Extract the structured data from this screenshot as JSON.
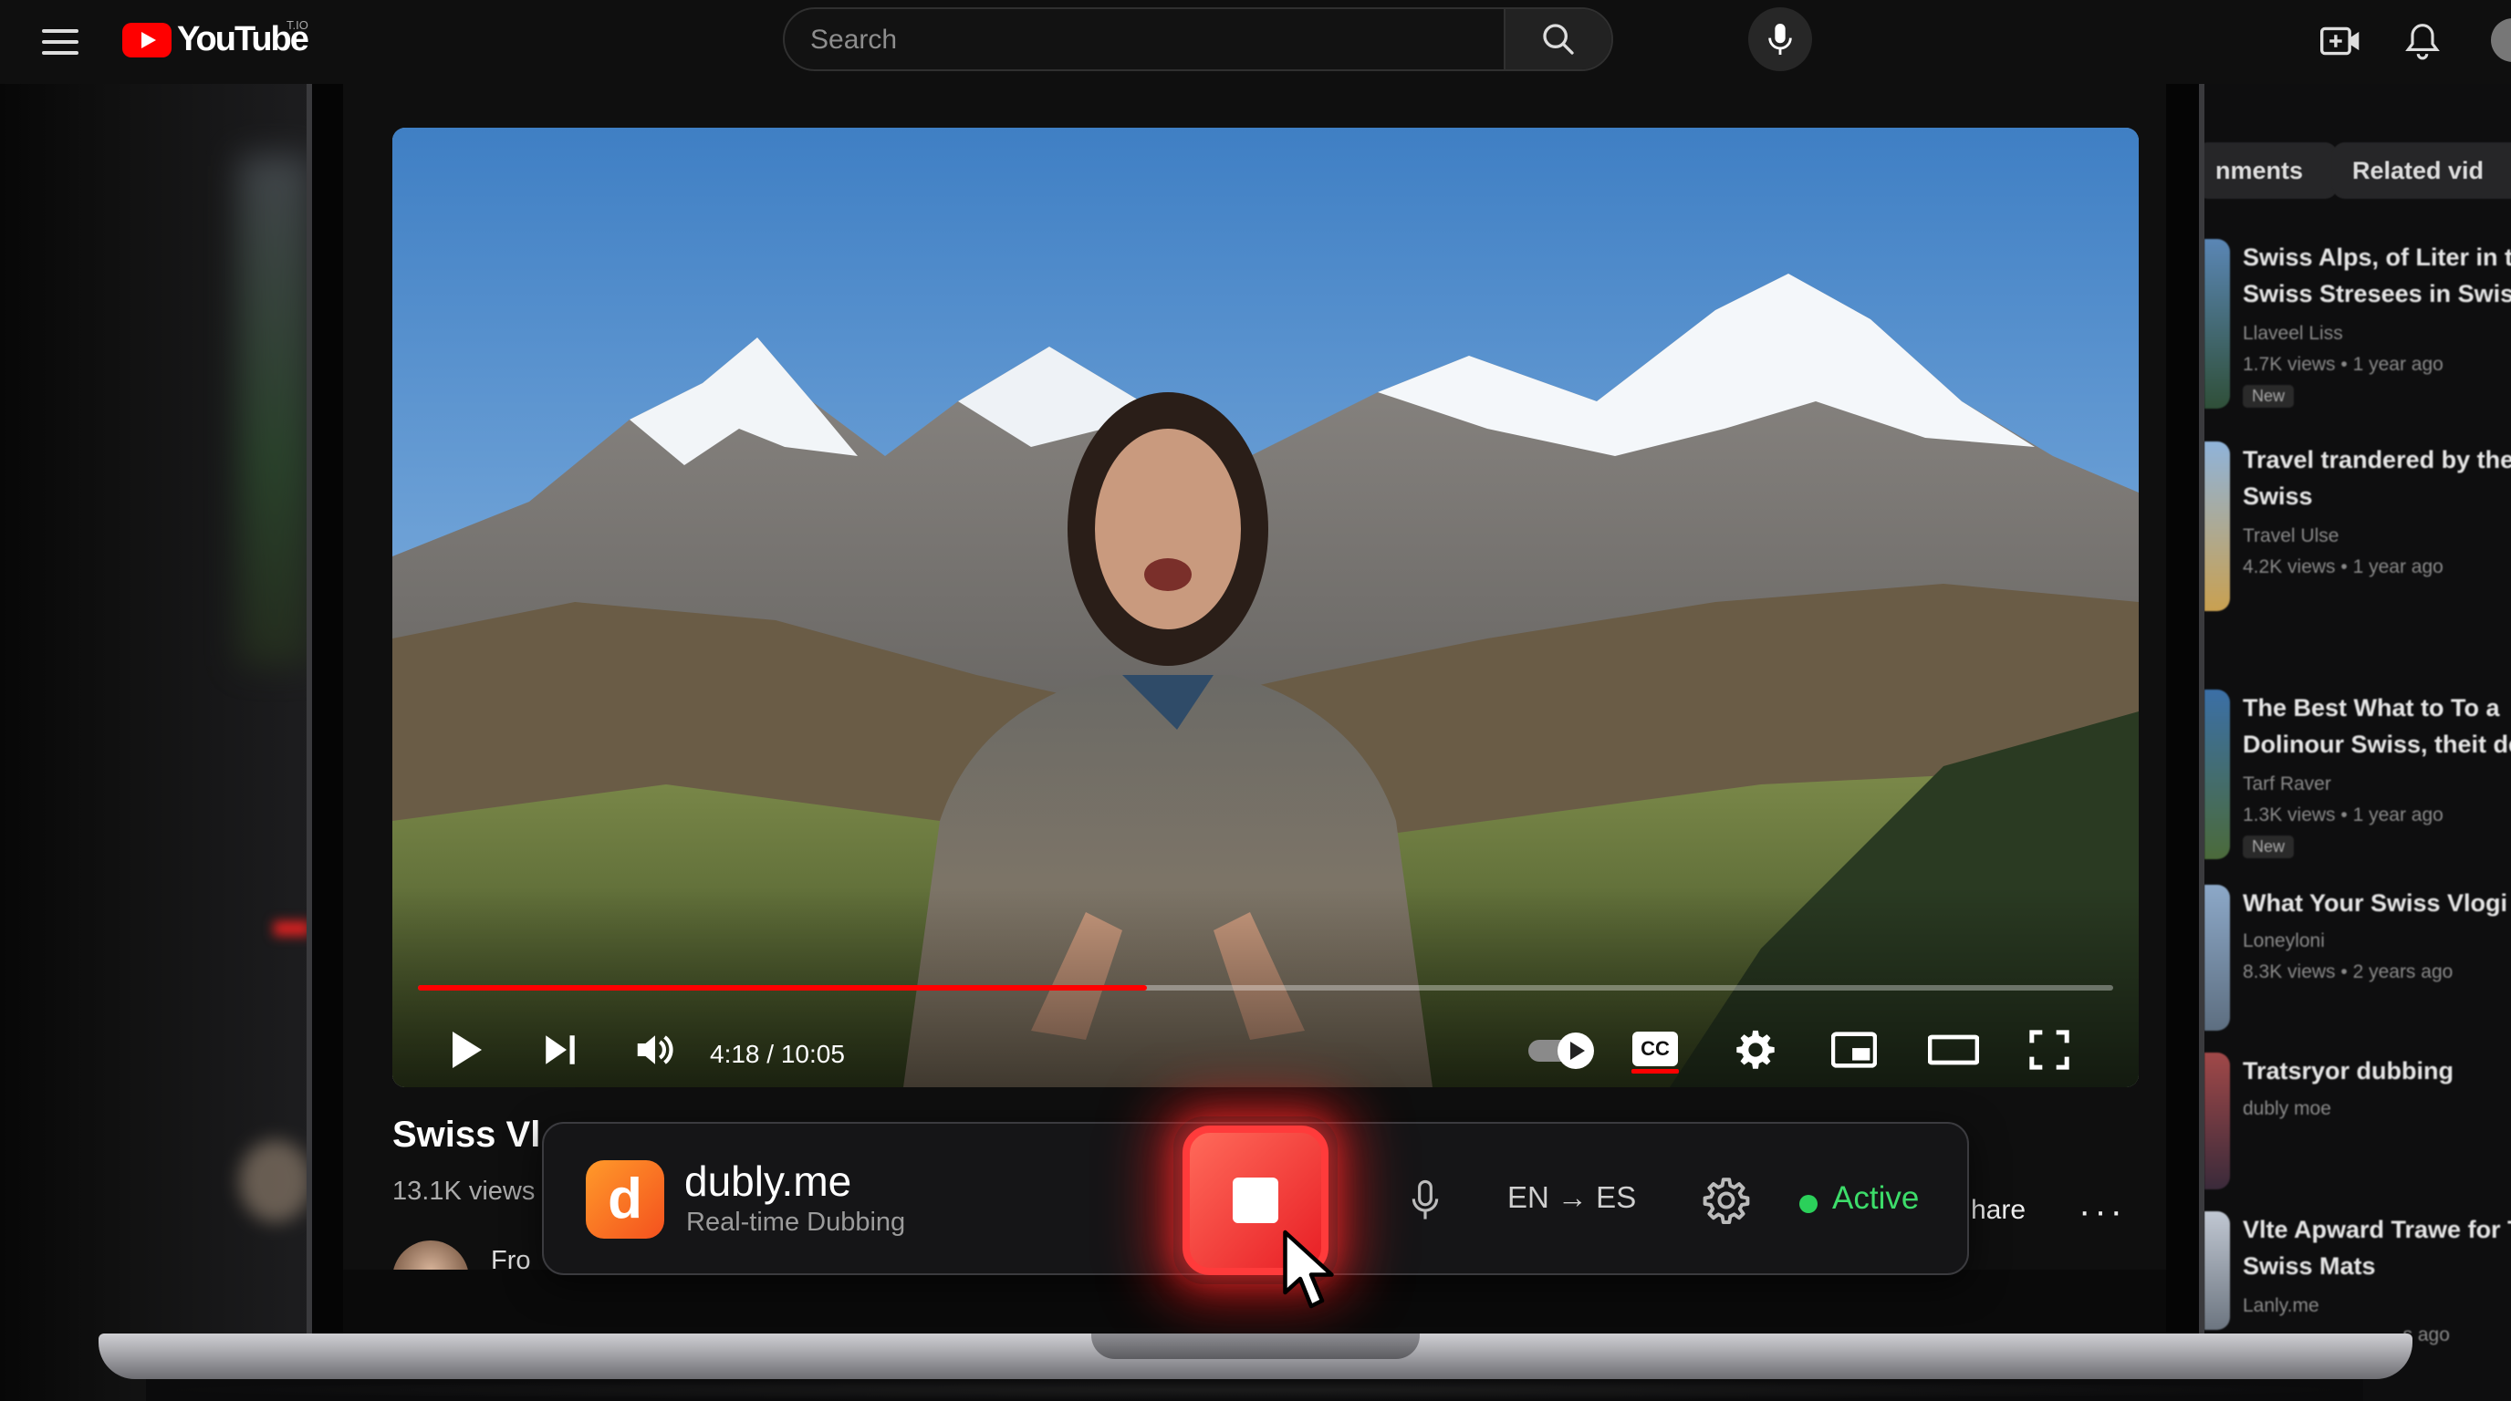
{
  "brand": {
    "logo_text": "YouTube",
    "logo_superscript": "T.IO",
    "accent_color": "#ff0000"
  },
  "search": {
    "placeholder": "Search",
    "icon": "search-icon"
  },
  "header_icons": [
    "menu-icon",
    "microphone-icon",
    "create-video-icon",
    "notifications-bell-icon",
    "avatar"
  ],
  "player": {
    "current_time": "4:18",
    "duration": "10:05",
    "time_display": "4:18 / 10:05",
    "progress": 0.43,
    "controls": [
      "play-icon",
      "next-icon",
      "volume-icon",
      "autoplay-toggle",
      "captions-icon",
      "settings-icon",
      "miniplayer-icon",
      "theater-icon",
      "fullscreen-icon"
    ],
    "cc_label": "CC"
  },
  "video": {
    "title": "Swiss Vl",
    "views": "13.1K views",
    "channel_text": "Fro",
    "share_label": "hare",
    "more_label": "···"
  },
  "dubly": {
    "logo_letter": "d",
    "name": "dubly.me",
    "tagline": "Real-time Dubbing",
    "language_pair": "EN → ES",
    "status": "Active",
    "status_color": "#2bd05a",
    "record_color": "#ff3b3b"
  },
  "sidebar": {
    "chips": [
      "nments",
      "Related vid"
    ],
    "items": [
      {
        "title1": "Swiss Alps, of Liter in th",
        "title2": "Swiss Stresees in Swiss",
        "channel": "Llaveel Liss",
        "meta": "1.7K views • 1 year ago",
        "badge": "New",
        "thumb_color": "#5a86b5"
      },
      {
        "title1": "Travel trandered by the",
        "title2": "Swiss",
        "channel": "Travel Ulse",
        "meta": "4.2K views • 1 year ago",
        "badge": "",
        "thumb_color": "#c9a050"
      },
      {
        "title1": "The Best What to To a",
        "title2": "Dolinour Swiss, theit de",
        "channel": "Tarf Raver",
        "meta": "1.3K views • 1 year ago",
        "badge": "New",
        "thumb_color": "#3b6fa6"
      },
      {
        "title1": "What Your Swiss Vlogi T",
        "title2": "",
        "channel": "Loneyloni",
        "meta": "8.3K views • 2 years ago",
        "badge": "",
        "thumb_color": "#8ca8c8"
      },
      {
        "title1": "Tratsryor dubbing",
        "title2": "",
        "channel": "dubly moe",
        "meta": "",
        "badge": "",
        "thumb_color": "#a04848"
      },
      {
        "title1": "Vlte Apward Trawe for Th",
        "title2": "Swiss Mats",
        "channel": "Lanly.me",
        "meta": "...s ago",
        "badge": "",
        "thumb_color": "#c0c7d2"
      }
    ]
  }
}
